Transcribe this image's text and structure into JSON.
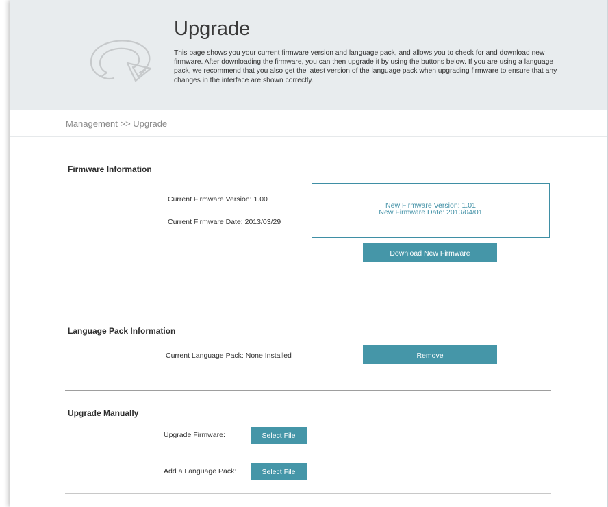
{
  "header": {
    "title": "Upgrade",
    "description": "This page shows you your current firmware version and language pack, and allows you to check for and download new firmware. After downloading the firmware, you can then upgrade it by using the buttons below. If you are using a language pack, we recommend that you also get the latest version of the language pack when upgrading firmware to ensure that any changes in the interface are shown correctly.",
    "icon": "upgrade-refresh-arrow-icon"
  },
  "breadcrumb": "Management >> Upgrade",
  "firmware": {
    "title": "Firmware Information",
    "current_version": "Current Firmware Version: 1.00",
    "current_date": "Current Firmware Date: 2013/03/29",
    "new_version": "New Firmware Version: 1.01",
    "new_date": "New Firmware Date: 2013/04/01",
    "download_button": "Download New Firmware"
  },
  "language": {
    "title": "Language Pack Information",
    "current_pack": "Current Language Pack: None Installed",
    "remove_button": "Remove"
  },
  "manual": {
    "title": "Upgrade Manually",
    "firmware_label": "Upgrade Firmware:",
    "firmware_button": "Select File",
    "language_label": "Add a Language Pack:",
    "language_button": "Select File"
  },
  "colors": {
    "accent": "#4596a8",
    "banner_bg": "#e8ecee",
    "box_border": "#3f8fa5"
  }
}
